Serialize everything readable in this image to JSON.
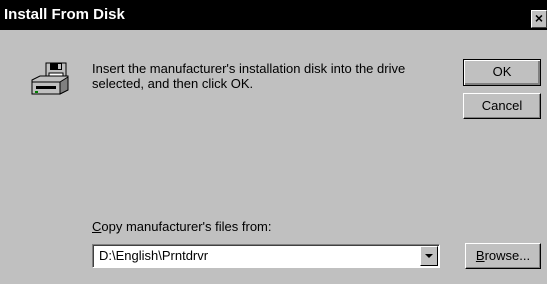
{
  "window": {
    "title": "Install From Disk",
    "close_glyph": "×"
  },
  "dialog": {
    "message": "Insert the manufacturer's installation disk into the drive selected, and then click OK.",
    "copy_label_prefix": "",
    "copy_label_mnemonic": "C",
    "copy_label_rest": "opy manufacturer's files from:",
    "path_value": "D:\\English\\Prntdrvr"
  },
  "buttons": {
    "ok": "OK",
    "cancel": "Cancel",
    "browse_mnemonic": "B",
    "browse_rest": "rowse..."
  },
  "icons": {
    "disk": "floppy-drive-icon",
    "dropdown": "chevron-down-icon"
  }
}
